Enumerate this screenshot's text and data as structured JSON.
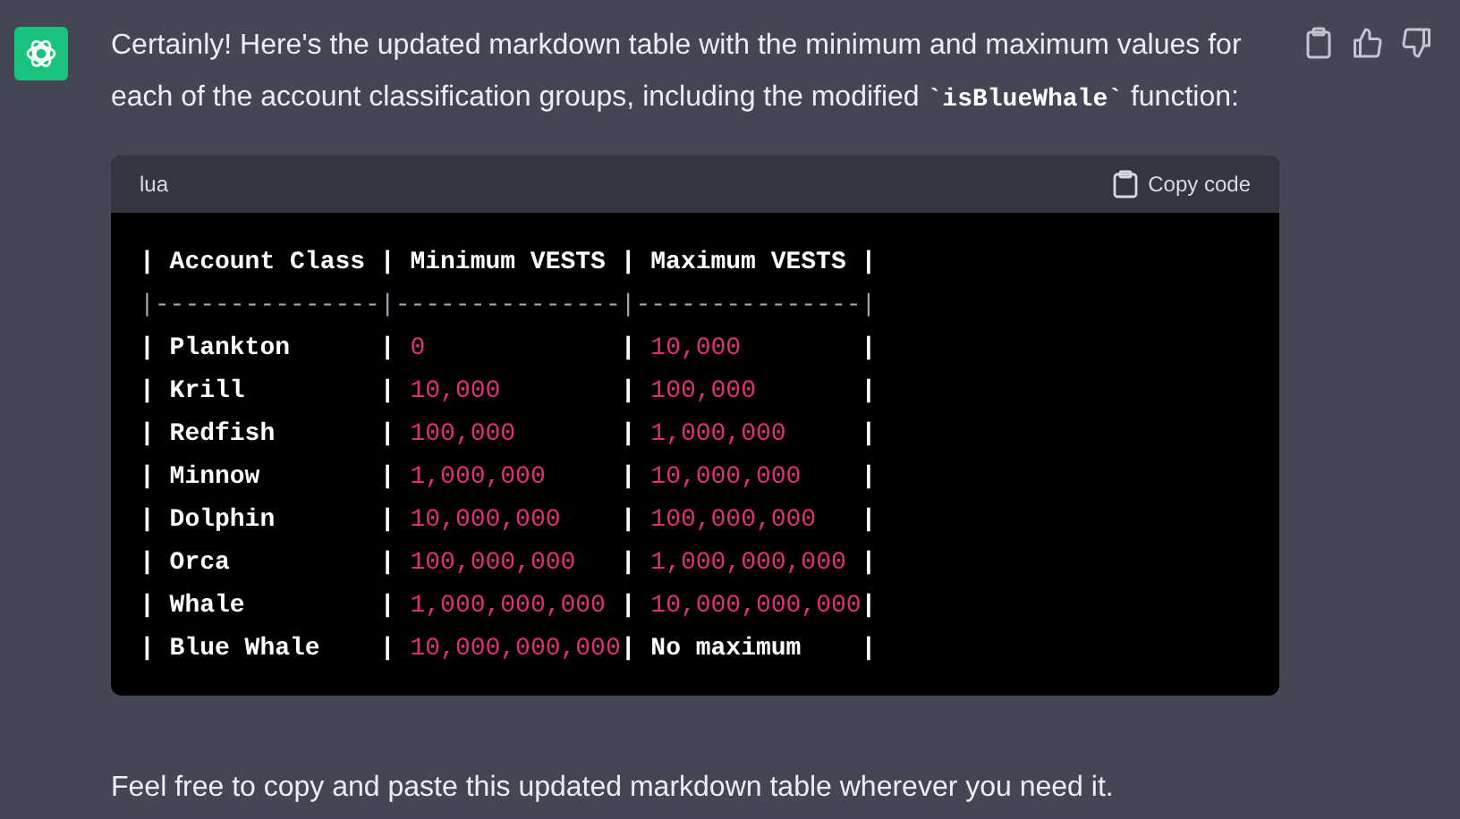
{
  "message": {
    "intro": {
      "before": "Certainly! Here's the updated markdown table with the minimum and maximum values for each of the account classification groups, including the modified ",
      "code": "`isBlueWhale`",
      "after": " function:"
    },
    "code_block": {
      "language": "lua",
      "copy_label": "Copy code",
      "lines": [
        [
          {
            "kind": "plain",
            "text": "| Account Class | Minimum VESTS | Maximum VESTS |"
          }
        ],
        [
          {
            "kind": "rule",
            "text": "|---------------|---------------|---------------|"
          }
        ],
        [
          {
            "kind": "plain",
            "text": "| Plankton      | "
          },
          {
            "kind": "number",
            "text": "0"
          },
          {
            "kind": "plain",
            "text": "             | "
          },
          {
            "kind": "number",
            "text": "10,000"
          },
          {
            "kind": "plain",
            "text": "        |"
          }
        ],
        [
          {
            "kind": "plain",
            "text": "| Krill         | "
          },
          {
            "kind": "number",
            "text": "10,000"
          },
          {
            "kind": "plain",
            "text": "        | "
          },
          {
            "kind": "number",
            "text": "100,000"
          },
          {
            "kind": "plain",
            "text": "       |"
          }
        ],
        [
          {
            "kind": "plain",
            "text": "| Redfish       | "
          },
          {
            "kind": "number",
            "text": "100,000"
          },
          {
            "kind": "plain",
            "text": "       | "
          },
          {
            "kind": "number",
            "text": "1,000,000"
          },
          {
            "kind": "plain",
            "text": "     |"
          }
        ],
        [
          {
            "kind": "plain",
            "text": "| Minnow        | "
          },
          {
            "kind": "number",
            "text": "1,000,000"
          },
          {
            "kind": "plain",
            "text": "     | "
          },
          {
            "kind": "number",
            "text": "10,000,000"
          },
          {
            "kind": "plain",
            "text": "    |"
          }
        ],
        [
          {
            "kind": "plain",
            "text": "| Dolphin       | "
          },
          {
            "kind": "number",
            "text": "10,000,000"
          },
          {
            "kind": "plain",
            "text": "    | "
          },
          {
            "kind": "number",
            "text": "100,000,000"
          },
          {
            "kind": "plain",
            "text": "   |"
          }
        ],
        [
          {
            "kind": "plain",
            "text": "| Orca          | "
          },
          {
            "kind": "number",
            "text": "100,000,000"
          },
          {
            "kind": "plain",
            "text": "   | "
          },
          {
            "kind": "number",
            "text": "1,000,000,000"
          },
          {
            "kind": "plain",
            "text": " |"
          }
        ],
        [
          {
            "kind": "plain",
            "text": "| Whale         | "
          },
          {
            "kind": "number",
            "text": "1,000,000,000"
          },
          {
            "kind": "plain",
            "text": " | "
          },
          {
            "kind": "number",
            "text": "10,000,000,000"
          },
          {
            "kind": "plain",
            "text": "|"
          }
        ],
        [
          {
            "kind": "plain",
            "text": "| Blue Whale    | "
          },
          {
            "kind": "number",
            "text": "10,000,000,000"
          },
          {
            "kind": "plain",
            "text": "| No maximum    |"
          }
        ]
      ]
    },
    "outro": "Feel free to copy and paste this updated markdown table wherever you need it."
  }
}
